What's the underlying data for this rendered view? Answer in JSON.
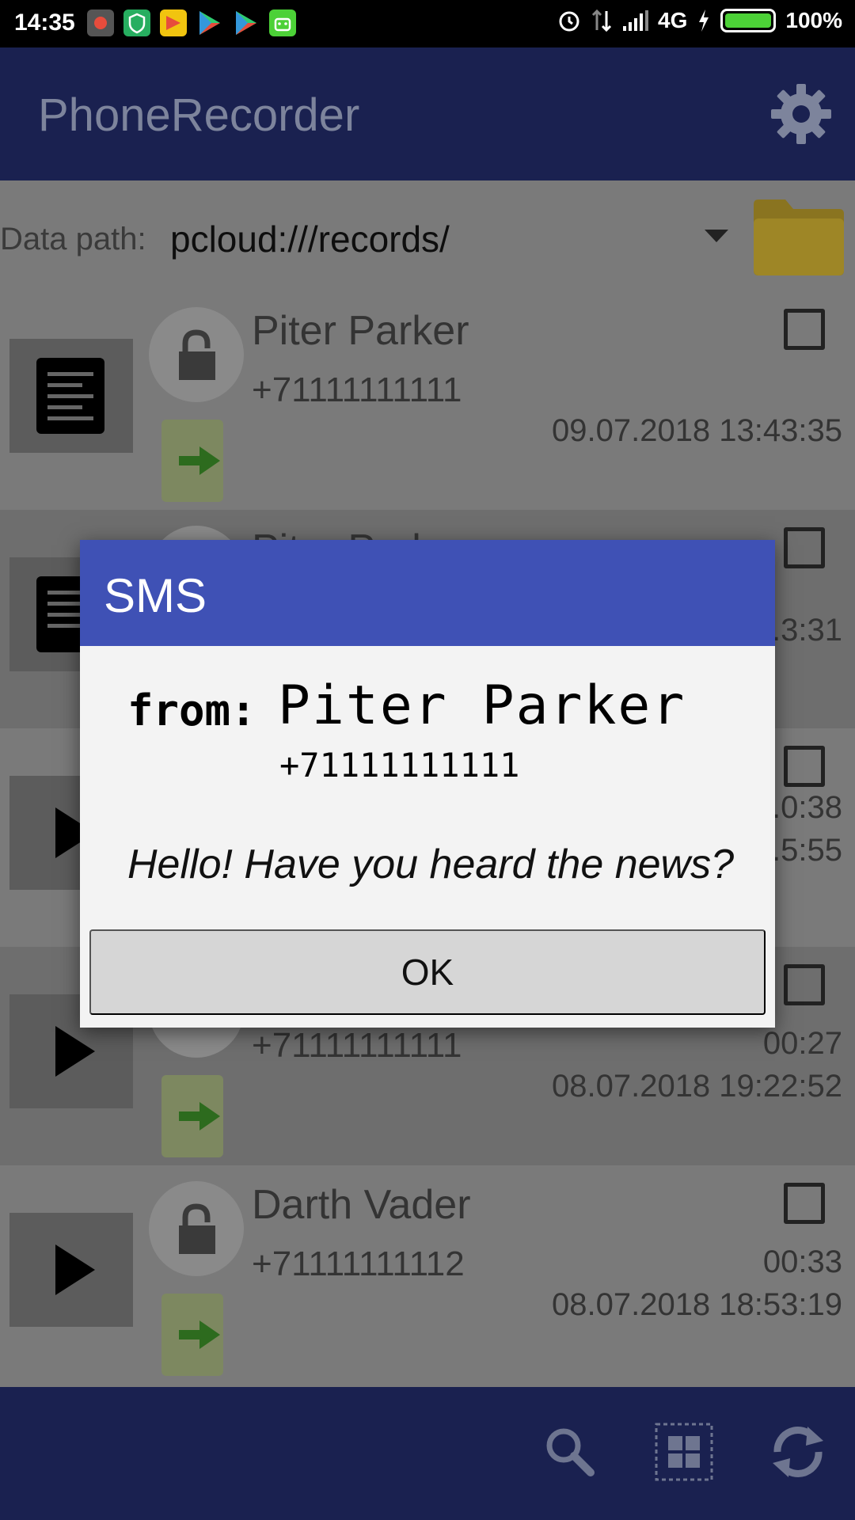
{
  "status_bar": {
    "time": "14:35",
    "network": "4G",
    "battery": "100%",
    "battery_level": 1.0,
    "left_icons": [
      "recorder-icon",
      "shield-icon",
      "app-icon",
      "play-store-icon",
      "play-store-icon",
      "android-icon"
    ],
    "right_icons": [
      "alarm-icon",
      "data-arrows-icon",
      "signal-icon",
      "charging-icon",
      "battery-icon"
    ]
  },
  "app_bar": {
    "title": "PhoneRecorder",
    "settings_icon": "gear-icon"
  },
  "path": {
    "label": "Data path:",
    "value": "pcloud:///records/"
  },
  "list": [
    {
      "name": "Piter Parker",
      "phone": "+71111111111",
      "duration": "",
      "date": "09.07.2018 13:43:35",
      "thumb_icon": "document-icon"
    },
    {
      "name": "Piter Parker",
      "phone": "",
      "duration": "",
      "date": "...3:31",
      "thumb_icon": "document-icon"
    },
    {
      "name": "",
      "phone": "",
      "duration": "...0:38",
      "date": "...5:55",
      "thumb_icon": "play-icon"
    },
    {
      "name": "",
      "phone": "+71111111111",
      "duration": "00:27",
      "date": "08.07.2018 19:22:52",
      "thumb_icon": "play-icon"
    },
    {
      "name": "Darth Vader",
      "phone": "+71111111112",
      "duration": "00:33",
      "date": "08.07.2018 18:53:19",
      "thumb_icon": "play-icon"
    }
  ],
  "bottom_bar": {
    "icons": [
      "search-icon",
      "grid-select-icon",
      "refresh-icon"
    ]
  },
  "dialog": {
    "title": "SMS",
    "from_label": "from:",
    "from_name": "Piter Parker",
    "from_phone": "+71111111111",
    "message": "Hello! Have you heard the news?",
    "ok_label": "OK"
  },
  "colors": {
    "app_bar": "#1a2150",
    "dialog_header": "#3f51b5",
    "dialog_body": "#f3f3f3",
    "ok_button": "#d6d6d6"
  }
}
